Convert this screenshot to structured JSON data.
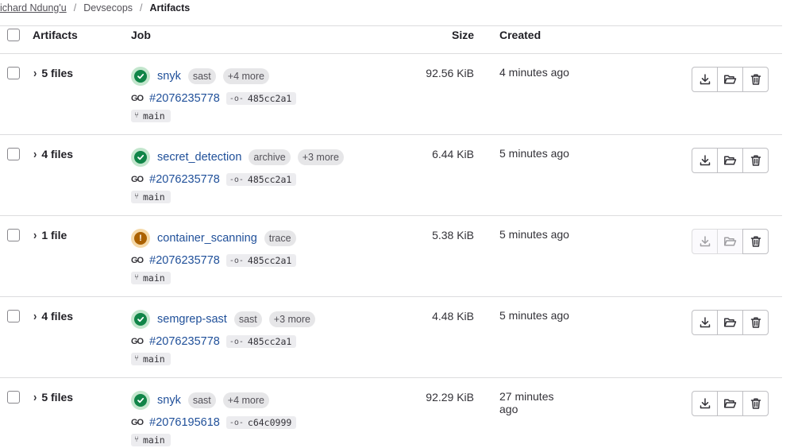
{
  "breadcrumb": {
    "user": "ichard Ndung'u",
    "project": "Devsecops",
    "current": "Artifacts",
    "separator": "/"
  },
  "table": {
    "headers": {
      "artifacts": "Artifacts",
      "job": "Job",
      "size": "Size",
      "created": "Created"
    },
    "rows": [
      {
        "files": "5 files",
        "status": "success",
        "job": "snyk",
        "badges": [
          "sast",
          "+4 more"
        ],
        "pipeline": "#2076235778",
        "sha": "485cc2a1",
        "branch": "main",
        "size": "92.56 KiB",
        "created": "4 minutes ago",
        "actions_disabled": false
      },
      {
        "files": "4 files",
        "status": "success",
        "job": "secret_detection",
        "badges": [
          "archive",
          "+3 more"
        ],
        "pipeline": "#2076235778",
        "sha": "485cc2a1",
        "branch": "main",
        "size": "6.44 KiB",
        "created": "5 minutes ago",
        "actions_disabled": false
      },
      {
        "files": "1 file",
        "status": "warning",
        "job": "container_scanning",
        "badges": [
          "trace"
        ],
        "pipeline": "#2076235778",
        "sha": "485cc2a1",
        "branch": "main",
        "size": "5.38 KiB",
        "created": "5 minutes ago",
        "actions_disabled": true
      },
      {
        "files": "4 files",
        "status": "success",
        "job": "semgrep-sast",
        "badges": [
          "sast",
          "+3 more"
        ],
        "pipeline": "#2076235778",
        "sha": "485cc2a1",
        "branch": "main",
        "size": "4.48 KiB",
        "created": "5 minutes ago",
        "actions_disabled": false
      },
      {
        "files": "5 files",
        "status": "success",
        "job": "snyk",
        "badges": [
          "sast",
          "+4 more"
        ],
        "pipeline": "#2076195618",
        "sha": "c64c0999",
        "branch": "main",
        "size": "92.29 KiB",
        "created": "27 minutes ago",
        "actions_disabled": false
      }
    ]
  },
  "icons": {
    "success": "check-circle-icon",
    "warning": "warning-icon",
    "pipeline": "pipeline-icon",
    "commit": "commit-icon",
    "branch": "branch-icon",
    "download": "download-icon",
    "browse": "folder-open-icon",
    "delete": "trash-icon"
  },
  "colors": {
    "link": "#1f4f99",
    "success": "#108548",
    "warning": "#ab6100"
  }
}
